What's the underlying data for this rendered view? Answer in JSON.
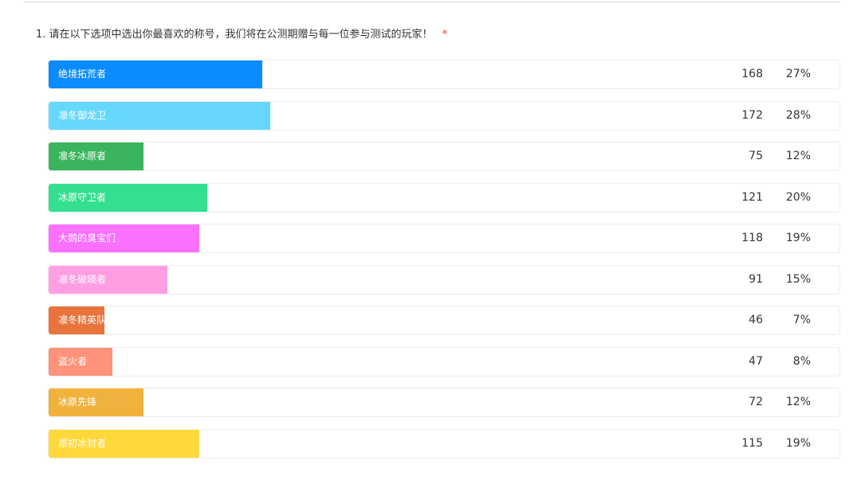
{
  "question": {
    "text": "1. 请在以下选项中选出你最喜欢的称号，我们将在公测期赠与每一位参与测试的玩家！",
    "required_mark": "*"
  },
  "chart_data": {
    "type": "bar",
    "orientation": "horizontal",
    "max_percent": 100,
    "categories": [
      "绝境拓荒者",
      "凛冬御龙卫",
      "凛冬冰原者",
      "冰原守卫者",
      "大鹅的臭宝们",
      "凛冬破晓者",
      "凛冬精英队",
      "盗火者",
      "冰原先锋",
      "原初冰封者"
    ],
    "values": [
      168,
      172,
      75,
      121,
      118,
      91,
      46,
      47,
      72,
      115
    ],
    "percents": [
      "27%",
      "28%",
      "12%",
      "20%",
      "19%",
      "15%",
      "7%",
      "8%",
      "12%",
      "19%"
    ],
    "percent_values": [
      27,
      28,
      12,
      20,
      19,
      15,
      7,
      8,
      12,
      19
    ],
    "colors": [
      "#0a8cff",
      "#66d8ff",
      "#3bb55c",
      "#34e08f",
      "#fa70ff",
      "#ff9ee3",
      "#e8733c",
      "#ff927a",
      "#f0b23c",
      "#ffd93b"
    ]
  }
}
